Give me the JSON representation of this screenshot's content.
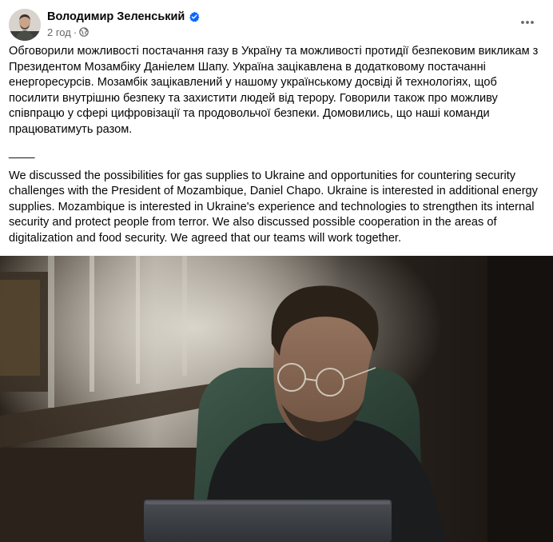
{
  "post": {
    "author": "Володимир Зеленський",
    "time": "2 год",
    "meta_separator": "·",
    "text_uk": "Обговорили можливості постачання газу в Україну та можливості протидії безпековим викликам з Президентом Мозамбіку Даніелем Шапу. Україна зацікавлена в додатковому постачанні енергоресурсів. Мозамбік зацікавлений у нашому українському досвіді й технологіях, щоб посилити внутрішню безпеку та захистити людей від терору. Говорили також про можливу співпрацю у сфері цифровізації та продовольчої безпеки. Домовились, що наші команди працюватимуть разом.",
    "divider": "____",
    "text_en": "We discussed the possibilities for gas supplies to Ukraine and opportunities for countering security challenges with the President of Mozambique, Daniel Chapo. Ukraine is interested in additional energy supplies. Mozambique is interested in Ukraine's experience and technologies to strengthen its internal security and protect people from terror. We also discussed possible cooperation in the areas of digitalization and food security. We agreed that our teams will work together."
  },
  "icons": {
    "verified": "verified-badge-icon",
    "audience": "globe-icon",
    "menu": "more-options-icon"
  },
  "colors": {
    "text": "#050505",
    "secondary_text": "#65676b",
    "verified_blue": "#0866ff"
  }
}
